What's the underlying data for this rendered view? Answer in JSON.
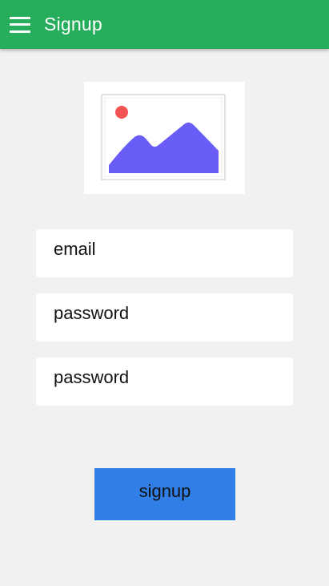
{
  "appbar": {
    "title": "Signup",
    "menu_icon": "hamburger-menu-icon",
    "background": "#27ae5c"
  },
  "image": {
    "icon": "image-placeholder-icon"
  },
  "form": {
    "email_placeholder": "email",
    "password_placeholder": "password",
    "confirm_password_placeholder": "password"
  },
  "signup_button": {
    "label": "signup",
    "color": "#2f7fe6"
  }
}
